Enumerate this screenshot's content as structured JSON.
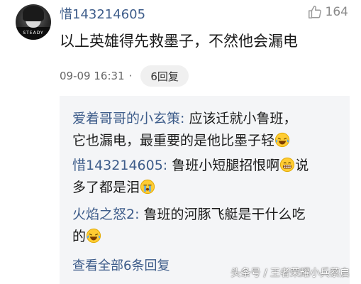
{
  "comment": {
    "username": "惜143214605",
    "likes": "164",
    "text": "以上英雄得先救墨子，不然他会漏电",
    "time": "09-09 16:31",
    "dot": "·",
    "reply_count_label": "6回复",
    "avatar_caption": "STEADY"
  },
  "replies": [
    {
      "name": "爱着哥哥的小玄策:",
      "line1": " 应该迁就小鲁班，",
      "line2": "它也漏电，最重要的是他比墨子轻",
      "emoji": "laugh-cry-emoji"
    },
    {
      "name": "惜143214605:",
      "line1a": " 鲁班小短腿招恨啊",
      "line1b": "说",
      "line2": "多了都是泪",
      "emojis": [
        "grin-emoji",
        "sob-emoji"
      ]
    },
    {
      "name": "火焰之怒2:",
      "line1": " 鲁班的河豚飞艇是干什么吃",
      "line2": "的",
      "emoji": "laugh-cry-emoji"
    }
  ],
  "view_all": "查看全部6条回复",
  "watermark": "头条号 / 王者荣耀小兵蔡启",
  "colors": {
    "name_blue": "#3d5c8a",
    "reply_bg": "#f4f5f7",
    "pill_bg": "#f0f0f0"
  }
}
